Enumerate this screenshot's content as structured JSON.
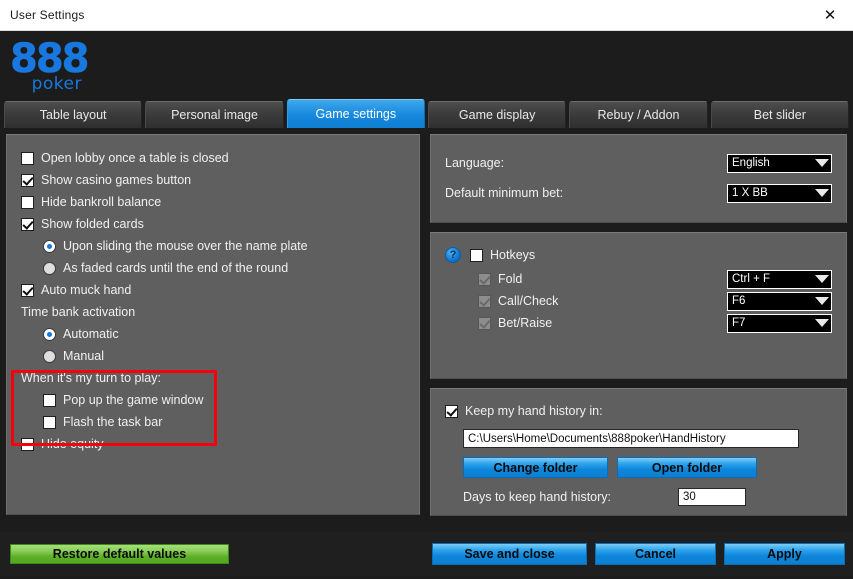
{
  "window": {
    "title": "User Settings",
    "close_icon": "close-icon"
  },
  "brand": {
    "logo_main": "888",
    "logo_sub": "poker"
  },
  "tabs": [
    {
      "label": "Table layout",
      "active": false
    },
    {
      "label": "Personal image",
      "active": false
    },
    {
      "label": "Game settings",
      "active": true
    },
    {
      "label": "Game display",
      "active": false
    },
    {
      "label": "Rebuy / Addon",
      "active": false
    },
    {
      "label": "Bet slider",
      "active": false
    }
  ],
  "left_panel": {
    "options": [
      {
        "label": "Open lobby once a table is closed",
        "checked": false
      },
      {
        "label": "Show casino games button",
        "checked": true
      },
      {
        "label": "Hide bankroll balance",
        "checked": false
      },
      {
        "label": "Show folded cards",
        "checked": true
      }
    ],
    "folded_cards_modes": [
      {
        "label": "Upon sliding the mouse over the name plate",
        "selected": true
      },
      {
        "label": "As faded cards until the end of the round",
        "selected": false
      }
    ],
    "auto_muck": {
      "label": "Auto muck hand",
      "checked": true
    },
    "time_bank_heading": "Time bank activation",
    "time_bank_modes": [
      {
        "label": "Automatic",
        "selected": true
      },
      {
        "label": "Manual",
        "selected": false
      }
    ],
    "turn_heading": "When it's my turn to play:",
    "turn_options": [
      {
        "label": "Pop up the game window",
        "checked": false
      },
      {
        "label": "Flash the task bar",
        "checked": false
      }
    ],
    "hide_equity": {
      "label": "Hide equity",
      "checked": false
    },
    "highlight_color": "#f5000f"
  },
  "language_panel": {
    "language_label": "Language:",
    "language_value": "English",
    "min_bet_label": "Default minimum bet:",
    "min_bet_value": "1 X BB"
  },
  "hotkeys_panel": {
    "help_icon": "help-icon",
    "help_glyph": "?",
    "heading": "Hotkeys",
    "heading_checked": false,
    "rows": [
      {
        "label": "Fold",
        "checked": true,
        "disabled": true,
        "key": "Ctrl + F"
      },
      {
        "label": "Call/Check",
        "checked": true,
        "disabled": true,
        "key": "F6"
      },
      {
        "label": "Bet/Raise",
        "checked": true,
        "disabled": true,
        "key": "F7"
      }
    ]
  },
  "hand_history_panel": {
    "keep_label": "Keep my hand history in:",
    "keep_checked": true,
    "path_value": "C:\\Users\\Home\\Documents\\888poker\\HandHistory",
    "change_folder_label": "Change folder",
    "open_folder_label": "Open folder",
    "days_label": "Days to keep hand history:",
    "days_value": "30"
  },
  "footer": {
    "restore_label": "Restore default values",
    "save_label": "Save and close",
    "cancel_label": "Cancel",
    "apply_label": "Apply",
    "restore_color": "#5cb027",
    "accent_color": "#1688dd"
  }
}
